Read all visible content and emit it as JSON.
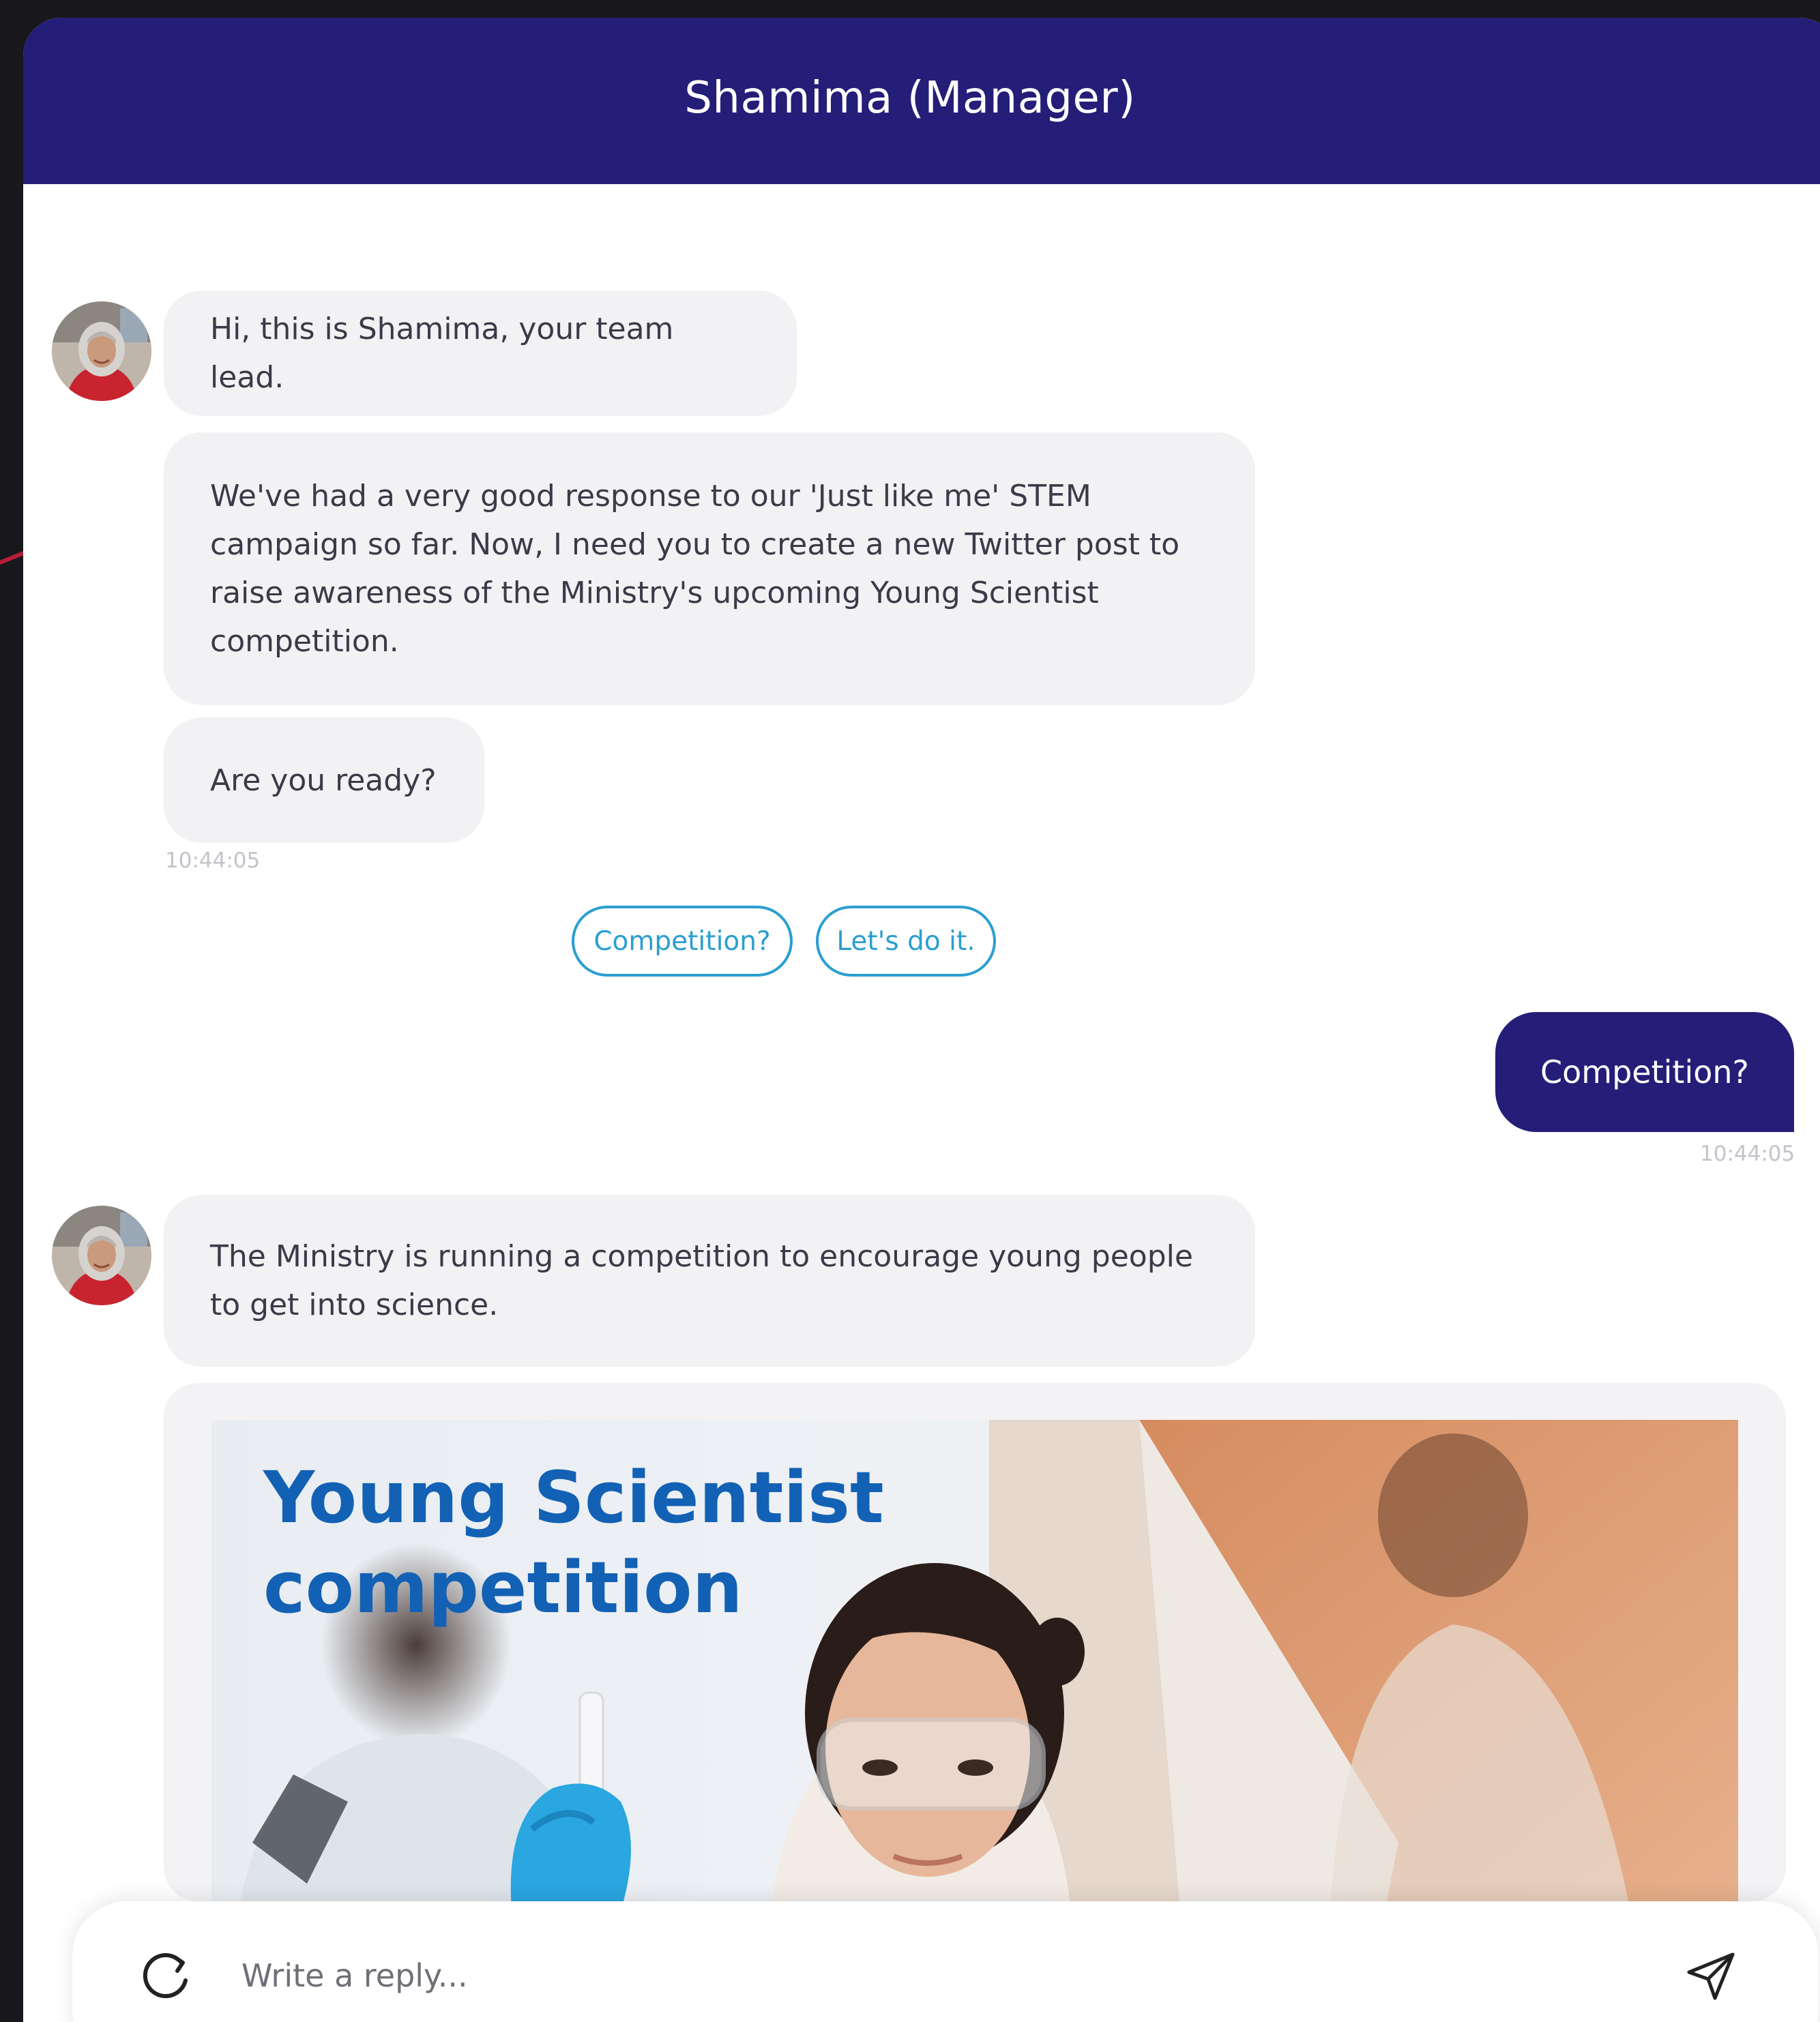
{
  "header": {
    "title": "Shamima (Manager)"
  },
  "messages": [
    {
      "text": "Hi, this is Shamima, your team lead."
    },
    {
      "text": "We've had a very good response to our 'Just like me' STEM\ncampaign so far. Now, I need you to create a new Twitter post to\nraise awareness of the Ministry's upcoming Young Scientist\ncompetition."
    },
    {
      "text": "Are you ready?"
    },
    {
      "text": "The Ministry is running a competition to encourage young people\nto get into science."
    }
  ],
  "timestamps": {
    "first_group": "10:44:05",
    "user_reply": "10:44:05"
  },
  "quick_replies": [
    {
      "label": "Competition?"
    },
    {
      "label": "Let's do it."
    }
  ],
  "user_message": {
    "text": "Competition?"
  },
  "poster": {
    "title": "Young Scientist\ncompetition"
  },
  "composer": {
    "placeholder": "Write a reply..."
  },
  "icons": {
    "refresh": "refresh-icon",
    "send": "send-icon"
  },
  "colors": {
    "header": "#241e78",
    "accent": "#2a9fd0",
    "bubble_in": "#f2f2f4",
    "poster_title": "#1261b4"
  }
}
